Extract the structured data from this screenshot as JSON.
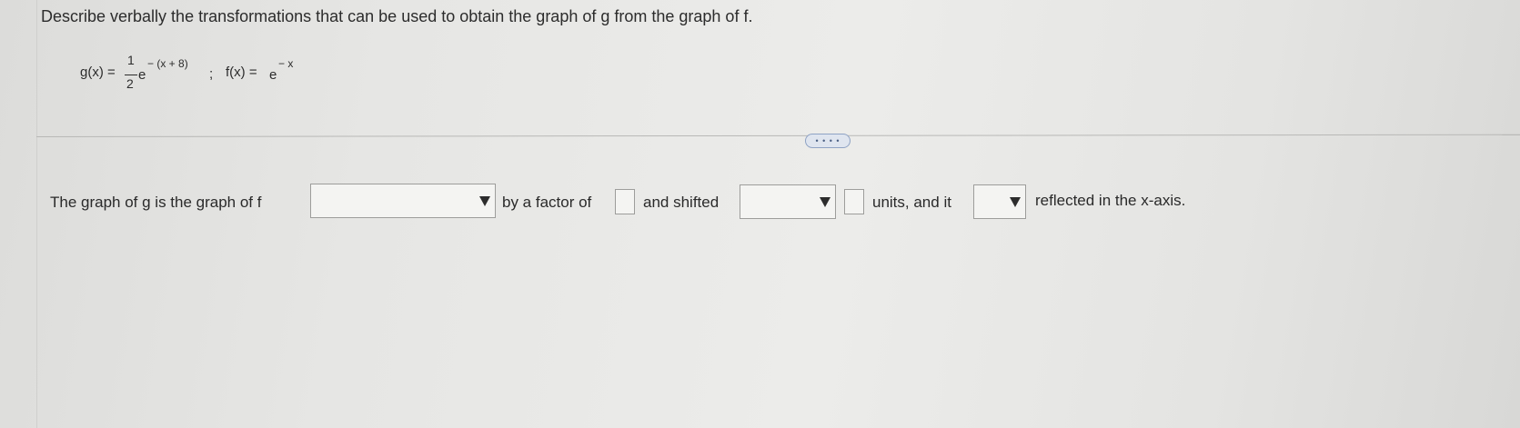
{
  "question": {
    "prompt": "Describe verbally the transformations that can be used to obtain the graph of g from the graph of f."
  },
  "formula": {
    "g_label": "g(x) =",
    "frac_numerator": "1",
    "frac_denominator": "2",
    "g_base": "e",
    "g_exponent": "− (x + 8)",
    "separator": ";",
    "f_label": "f(x) =",
    "f_base": "e",
    "f_exponent": "− x"
  },
  "more_button": {
    "label": "• • • •"
  },
  "answer": {
    "text_1": "The graph of g is the graph of f",
    "text_2": "by a factor of",
    "text_3": "and shifted",
    "text_4": "units, and it",
    "text_5": "reflected in the x-axis.",
    "dropdown_1_value": "",
    "factor_value": "",
    "dropdown_2_value": "",
    "units_value": "",
    "dropdown_3_value": ""
  }
}
